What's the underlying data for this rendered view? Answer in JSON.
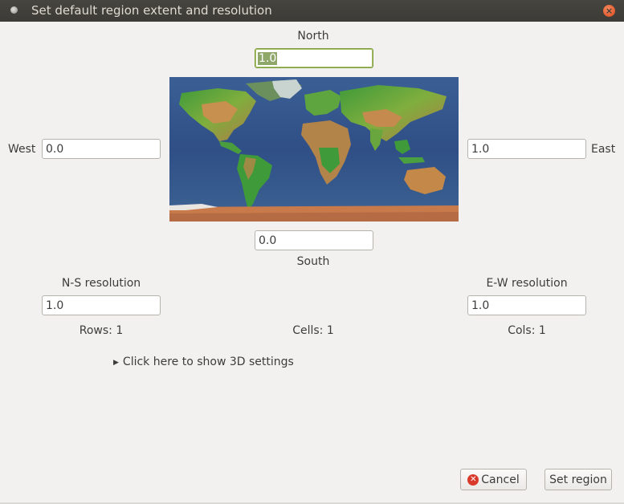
{
  "window": {
    "title": "Set default region extent and resolution"
  },
  "extent": {
    "north_label": "North",
    "north_value": "1.0",
    "west_label": "West",
    "west_value": "0.0",
    "east_label": "East",
    "east_value": "1.0",
    "south_label": "South",
    "south_value": "0.0"
  },
  "resolution": {
    "ns_label": "N-S resolution",
    "ns_value": "1.0",
    "ew_label": "E-W resolution",
    "ew_value": "1.0"
  },
  "stats": {
    "rows": "Rows: 1",
    "cells": "Cells: 1",
    "cols": "Cols: 1"
  },
  "expander": {
    "label": "Click here to show 3D settings",
    "expanded": false
  },
  "buttons": {
    "cancel": "Cancel",
    "set_region": "Set region"
  },
  "colors": {
    "focus_border": "#7d9b3f",
    "selection": "#8fa86a",
    "close": "#d9471c"
  },
  "icons": {
    "close": "close-icon",
    "cancel": "cancel-icon",
    "expander": "triangle-right-icon",
    "map": "world-map-image"
  }
}
